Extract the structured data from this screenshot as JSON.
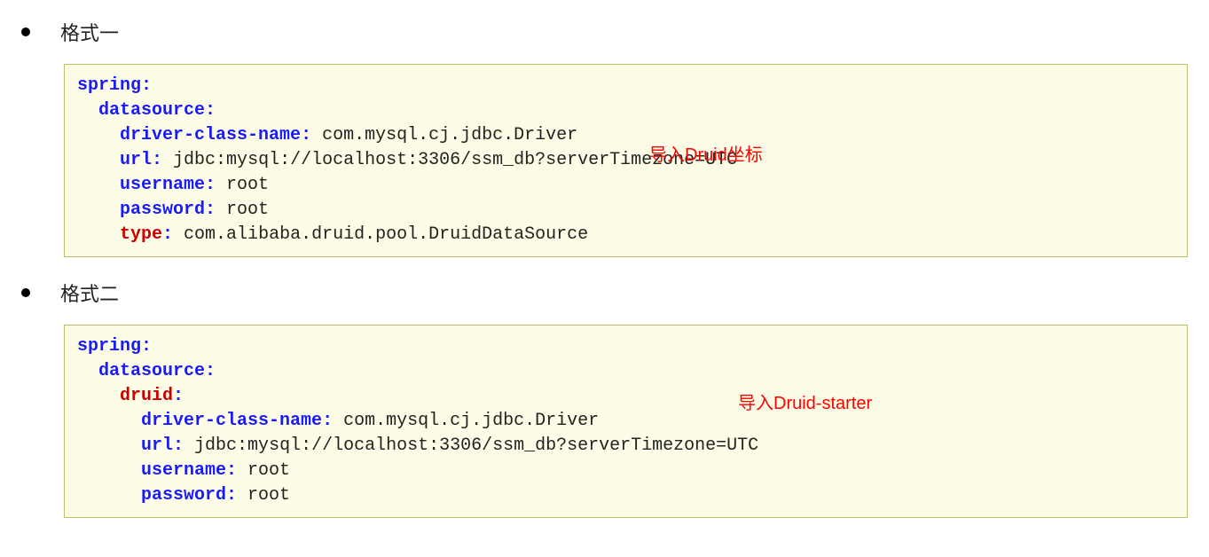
{
  "sections": [
    {
      "heading": "格式一",
      "annotation": "导入Druid坐标",
      "code": {
        "l1_key": "spring",
        "l1_colon": ":",
        "l2_indent": "  ",
        "l2_key": "datasource",
        "l2_colon": ":",
        "l3_indent": "    ",
        "l3_key": "driver-class-name",
        "l3_colon": ":",
        "l3_val": " com.mysql.cj.jdbc.Driver",
        "l4_indent": "    ",
        "l4_key": "url",
        "l4_colon": ":",
        "l4_val": " jdbc:mysql://localhost:3306/ssm_db?serverTimezone=UTC",
        "l5_indent": "    ",
        "l5_key": "username",
        "l5_colon": ":",
        "l5_val": " root",
        "l6_indent": "    ",
        "l6_key": "password",
        "l6_colon": ":",
        "l6_val": " root",
        "l7_indent": "    ",
        "l7_key": "type",
        "l7_colon": ":",
        "l7_val": " com.alibaba.druid.pool.DruidDataSource"
      }
    },
    {
      "heading": "格式二",
      "annotation": "导入Druid-starter",
      "code": {
        "l1_key": "spring",
        "l1_colon": ":",
        "l2_indent": "  ",
        "l2_key": "datasource",
        "l2_colon": ":",
        "l3_indent": "    ",
        "l3_key": "druid",
        "l3_colon": ":",
        "l4_indent": "      ",
        "l4_key": "driver-class-name",
        "l4_colon": ":",
        "l4_val": " com.mysql.cj.jdbc.Driver",
        "l5_indent": "      ",
        "l5_key": "url",
        "l5_colon": ":",
        "l5_val": " jdbc:mysql://localhost:3306/ssm_db?serverTimezone=UTC",
        "l6_indent": "      ",
        "l6_key": "username",
        "l6_colon": ":",
        "l6_val": " root",
        "l7_indent": "      ",
        "l7_key": "password",
        "l7_colon": ":",
        "l7_val": " root"
      }
    }
  ]
}
